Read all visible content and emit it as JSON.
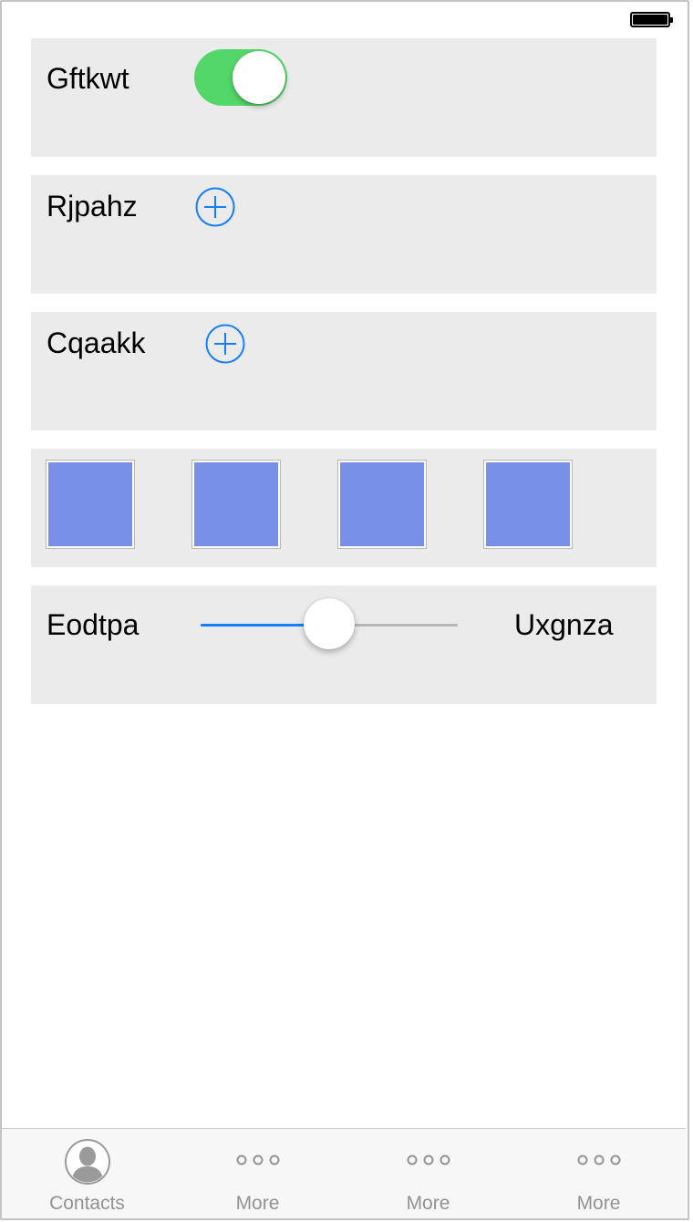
{
  "status_bar": {
    "battery_icon": "battery-full-icon"
  },
  "rows": {
    "switch": {
      "label": "Gftkwt",
      "on": true,
      "color": "#53d769"
    },
    "add1": {
      "label": "Rjpahz",
      "icon": "add-circle-icon"
    },
    "add2": {
      "label": "Cqaakk",
      "icon": "add-circle-icon"
    },
    "thumbnails": {
      "count": 4,
      "color": "#7890e6"
    },
    "slider": {
      "min_label": "Eodtpa",
      "max_label": "Uxgnza",
      "value": 0.5,
      "tint": "#157efb"
    }
  },
  "tabbar": {
    "tabs": [
      {
        "label": "Contacts",
        "icon": "contacts-icon",
        "selected": true
      },
      {
        "label": "More",
        "icon": "more-icon"
      },
      {
        "label": "More",
        "icon": "more-icon"
      },
      {
        "label": "More",
        "icon": "more-icon"
      }
    ]
  }
}
